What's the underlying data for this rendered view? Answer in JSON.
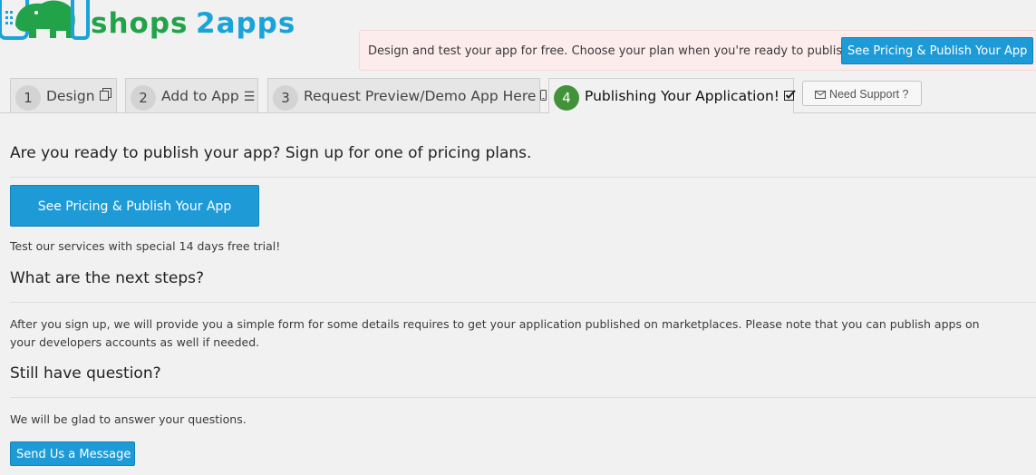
{
  "brand": {
    "name": "shops2apps"
  },
  "promo": {
    "text": "Design and test your app for free. Choose your plan when you're ready to publish it.",
    "button_label": "See Pricing & Publish Your App"
  },
  "tabs": [
    {
      "number": "1",
      "label": "Design",
      "icon": "copy-icon"
    },
    {
      "number": "2",
      "label": "Add to App",
      "icon": "list-icon"
    },
    {
      "number": "3",
      "label": "Request Preview/Demo App Here",
      "icon": "mobile-icon"
    },
    {
      "number": "4",
      "label": "Publishing Your Application!",
      "icon": "check-square-icon"
    }
  ],
  "support": {
    "label": "Need Support ?",
    "icon": "envelope-icon"
  },
  "main": {
    "publish_heading": "Are you ready to publish your app? Sign up for one of pricing plans.",
    "publish_button": "See Pricing & Publish Your App",
    "trial_text": "Test our services with special 14 days free trial!",
    "next_heading": "What are the next steps?",
    "next_text": "After you sign up, we will provide you a simple form for some details requires to get your application published on marketplaces. Please note that you can publish apps on your developers accounts as well if needed.",
    "question_heading": "Still have question?",
    "question_text": "We will be glad to answer your questions.",
    "message_button": "Send Us a Message"
  },
  "colors": {
    "accent": "#1e9bd7",
    "brand_green": "#22a34a",
    "brand_blue": "#1aa3d9",
    "active_step": "#42923a",
    "promo_bg": "#fcecec"
  }
}
